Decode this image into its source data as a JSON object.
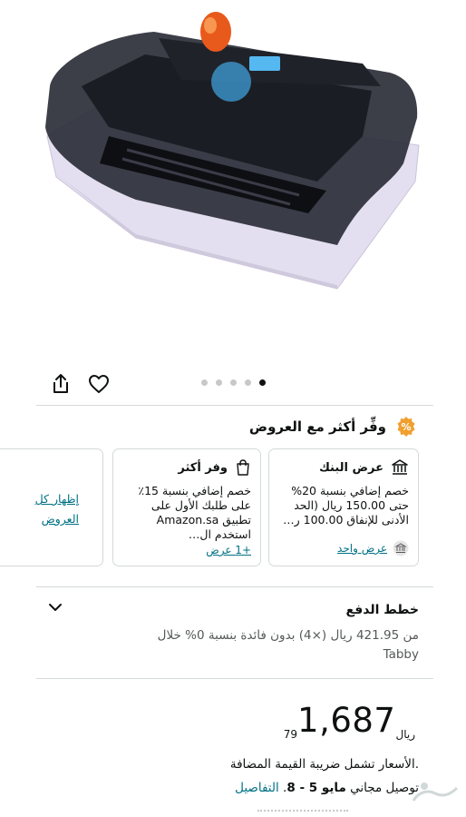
{
  "gallery": {
    "image_alt": "Egg incubator with transparent lid",
    "dot_count": 5,
    "active_dot": 5
  },
  "actions": {
    "share_icon": "share-icon",
    "favorite_icon": "heart-icon"
  },
  "offers": {
    "title": "وفِّر أكثر مع العروض",
    "badge_icon": "percent-badge-icon",
    "bank": {
      "title": "عرض البنك",
      "icon": "bank-icon",
      "body": "خصم إضافي بنسبة 20% حتى 150.00 ريال (الحد الأدنى للإنفاق 100.00 ر…",
      "link": "عرض واحد"
    },
    "save_more": {
      "title": "وفر أكثر",
      "icon": "shopping-bag-icon",
      "body": "خصم إضافي بنسبة 15٪ على طلبك الأول على تطبيق Amazon.sa استخدم ال…",
      "link": "+1 عرض"
    },
    "show_all": "إظهار كل العروض"
  },
  "payment": {
    "title": "خطط الدفع",
    "description": "من 421.95 ريال (×4) بدون فائدة بنسبة 0% خلال Tabby"
  },
  "price": {
    "currency": "ريال",
    "whole": "1,687",
    "fraction": "79",
    "vat_note": ".الأسعار تشمل ضريبة القيمة المضافة",
    "delivery_prefix": "توصيل مجاني",
    "delivery_date": "مايو 5 - 8",
    "delivery_details": "التفاصيل"
  },
  "colors": {
    "link": "#007185",
    "badge": "#f0a030",
    "text": "#0f1111"
  }
}
